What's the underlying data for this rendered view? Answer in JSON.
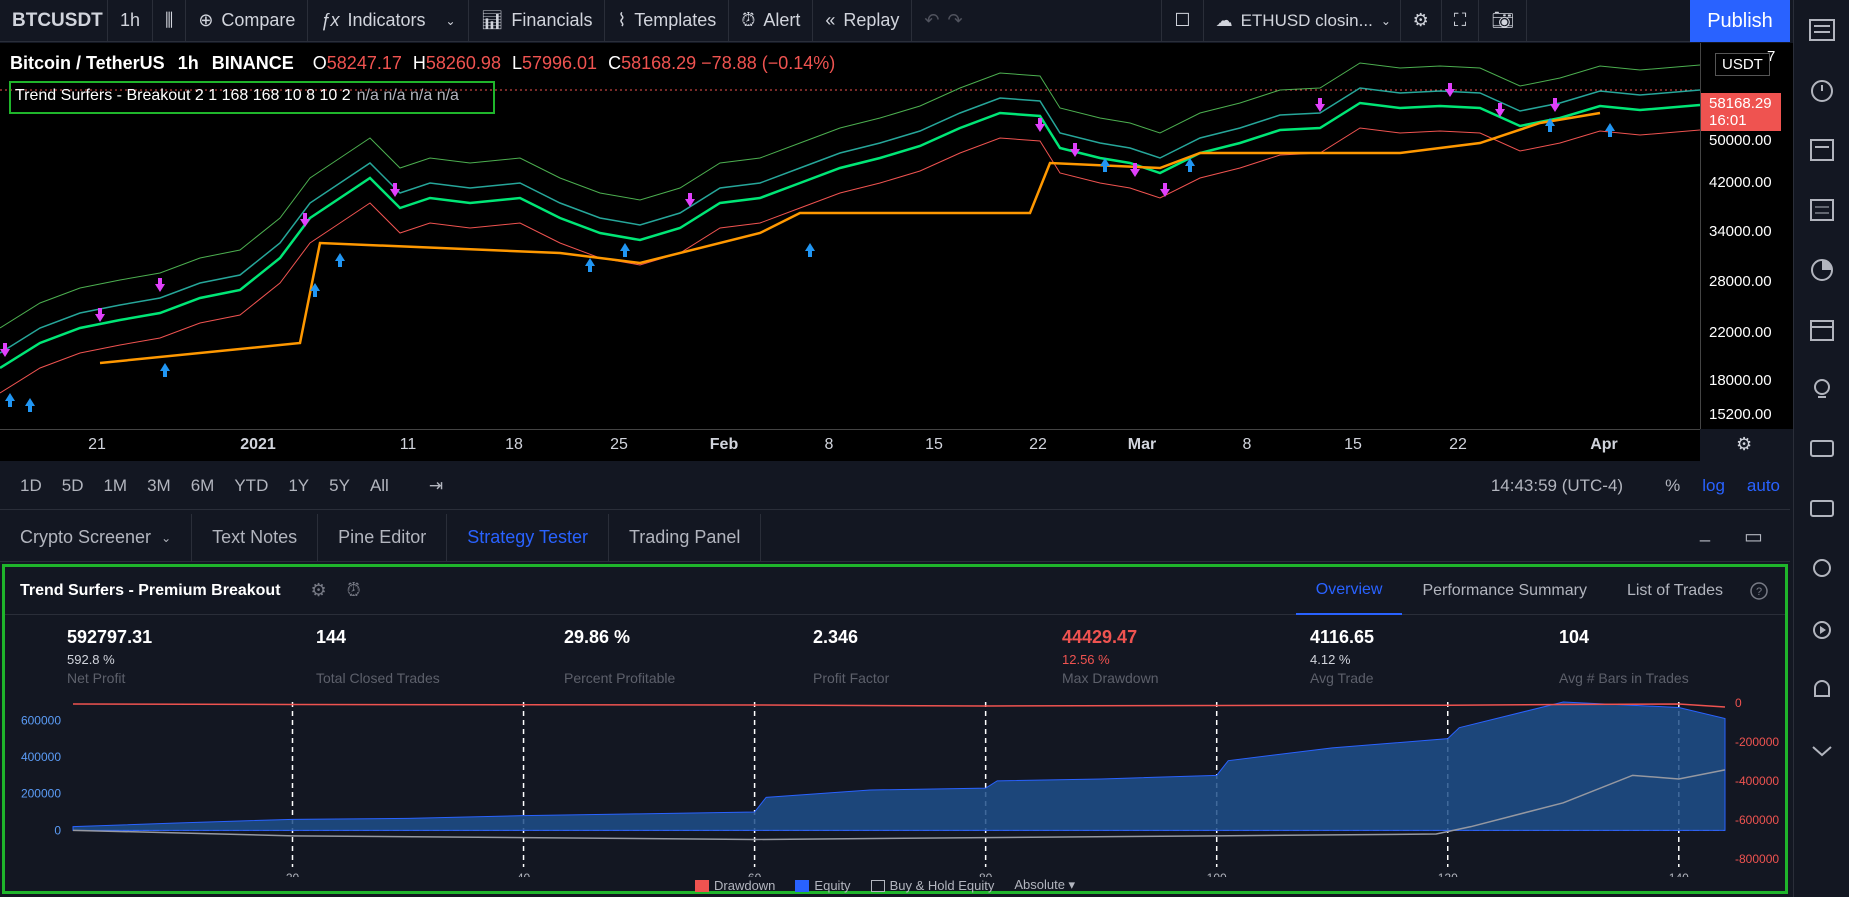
{
  "toolbar": {
    "symbol": "BTCUSDT",
    "interval": "1h",
    "compare": "Compare",
    "indicators": "Indicators",
    "financials": "Financials",
    "templates": "Templates",
    "alert": "Alert",
    "replay": "Replay",
    "alert_name": "ETHUSD closin...",
    "publish": "Publish"
  },
  "legend": {
    "title": "Bitcoin / TetherUS",
    "interval": "1h",
    "exchange": "BINANCE",
    "o_label": "O",
    "o": "58247.17",
    "h_label": "H",
    "h": "58260.98",
    "l_label": "L",
    "l": "57996.01",
    "c_label": "C",
    "c": "58168.29",
    "change": "−78.88 (−0.14%)",
    "strategy": "Trend Surfers - Breakout 2 1 168 168 10 8 10 2",
    "na": "n/a n/a n/a n/a"
  },
  "price_axis": {
    "currency": "USDT",
    "ticks": [
      "50000.00",
      "42000.00",
      "34000.00",
      "28000.00",
      "22000.00",
      "18000.00",
      "15200.00"
    ],
    "last_price": "58168.29",
    "countdown": "16:01",
    "top_tick": "7"
  },
  "time_axis": [
    "21",
    "2021",
    "11",
    "18",
    "25",
    "Feb",
    "8",
    "15",
    "22",
    "Mar",
    "8",
    "15",
    "22",
    "Apr"
  ],
  "ranges": [
    "1D",
    "5D",
    "1M",
    "3M",
    "6M",
    "YTD",
    "1Y",
    "5Y",
    "All"
  ],
  "clock": "14:43:59 (UTC-4)",
  "scale": {
    "pct": "%",
    "log": "log",
    "auto": "auto"
  },
  "bottom_tabs": [
    "Crypto Screener",
    "Text Notes",
    "Pine Editor",
    "Strategy Tester",
    "Trading Panel"
  ],
  "strategy_tester": {
    "name": "Trend Surfers - Premium Breakout",
    "tabs": [
      "Overview",
      "Performance Summary",
      "List of Trades"
    ],
    "stats": [
      {
        "value": "592797.31",
        "sub": "592.8 %",
        "label": "Net Profit"
      },
      {
        "value": "144",
        "sub": "",
        "label": "Total Closed Trades"
      },
      {
        "value": "29.86 %",
        "sub": "",
        "label": "Percent Profitable"
      },
      {
        "value": "2.346",
        "sub": "",
        "label": "Profit Factor"
      },
      {
        "value": "44429.47",
        "sub": "12.56 %",
        "label": "Max Drawdown"
      },
      {
        "value": "4116.65",
        "sub": "4.12 %",
        "label": "Avg Trade"
      },
      {
        "value": "104",
        "sub": "",
        "label": "Avg # Bars in Trades"
      }
    ],
    "left_axis": [
      "600000",
      "400000",
      "200000",
      "0"
    ],
    "right_axis": [
      "0",
      "-200000",
      "-400000",
      "-600000",
      "-800000"
    ],
    "x_axis": [
      "20",
      "40",
      "60",
      "80",
      "100",
      "120",
      "140"
    ],
    "legend": [
      "Drawdown",
      "Equity",
      "Buy & Hold Equity",
      "Absolute"
    ]
  },
  "chart_data": {
    "type": "area",
    "x_range": [
      1,
      144
    ],
    "series": [
      {
        "name": "Equity",
        "x": [
          1,
          10,
          20,
          30,
          40,
          50,
          60,
          61,
          70,
          80,
          81,
          90,
          100,
          101,
          110,
          120,
          121,
          130,
          140,
          144
        ],
        "values": [
          20000,
          40000,
          60000,
          65000,
          80000,
          90000,
          100000,
          180000,
          220000,
          230000,
          270000,
          280000,
          300000,
          380000,
          450000,
          500000,
          560000,
          700000,
          670000,
          610000
        ]
      },
      {
        "name": "Drawdown",
        "x": [
          1,
          20,
          40,
          60,
          80,
          100,
          120,
          130,
          140,
          144
        ],
        "values": [
          0,
          -5000,
          -8000,
          -10000,
          -20000,
          -15000,
          -12000,
          -5000,
          0,
          -30000
        ]
      },
      {
        "name": "Buy & Hold Equity",
        "x": [
          1,
          20,
          40,
          60,
          80,
          100,
          119,
          122,
          130,
          136,
          140,
          144
        ],
        "values": [
          0,
          -30000,
          -40000,
          -50000,
          -40000,
          -30000,
          -20000,
          20000,
          150000,
          300000,
          280000,
          330000
        ]
      }
    ]
  }
}
